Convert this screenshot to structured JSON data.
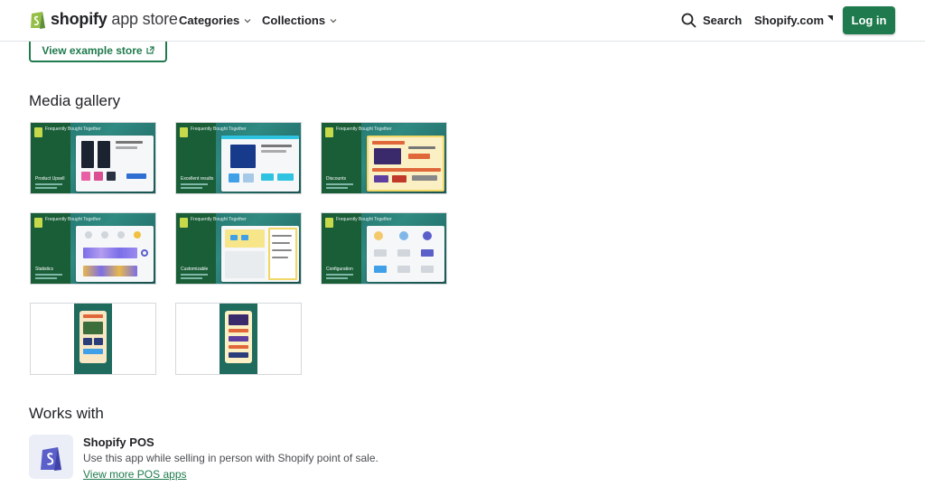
{
  "header": {
    "logo_brand": "shopify",
    "logo_suffix": "app store",
    "nav": [
      {
        "label": "Categories",
        "icon": "chevron-down-icon"
      },
      {
        "label": "Collections",
        "icon": "chevron-down-icon"
      }
    ],
    "search_label": "Search",
    "shopify_com_label": "Shopify.com",
    "login_label": "Log in"
  },
  "example_store": {
    "label": "View example store",
    "icon": "external-link-icon"
  },
  "media_gallery": {
    "title": "Media gallery",
    "thumbnail_header": "Frequently Bought Together",
    "items": [
      {
        "label": "Product Upsell"
      },
      {
        "label": "Excellent results"
      },
      {
        "label": "Discounts"
      },
      {
        "label": "Statistics"
      },
      {
        "label": "Customizable"
      },
      {
        "label": "Configuration"
      },
      {
        "label": ""
      },
      {
        "label": ""
      }
    ]
  },
  "works_with": {
    "title": "Works with",
    "app_name": "Shopify POS",
    "description": "Use this app while selling in person with Shopify point of sale.",
    "link": "View more POS apps",
    "icon": "shopify-bag-icon"
  },
  "colors": {
    "accent_green": "#1f7a4d",
    "thumbnail_teal": "#1d6e68",
    "pos_icon_blue": "#5a5fc9"
  }
}
